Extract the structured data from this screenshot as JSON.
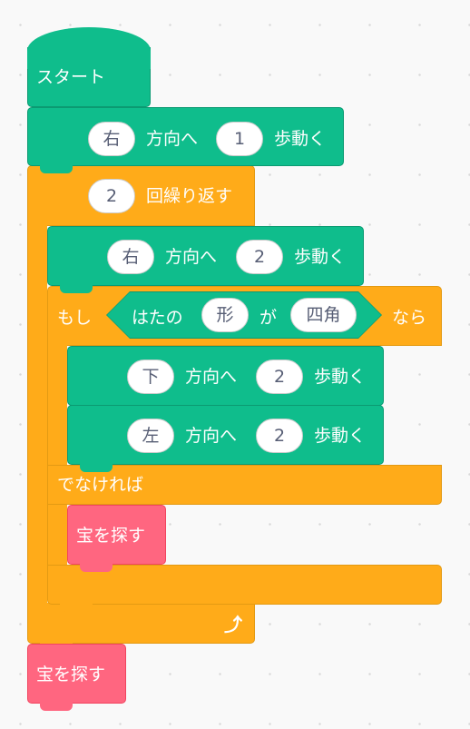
{
  "colors": {
    "motion": "#0fbd8c",
    "control": "#ffab19",
    "action": "#ff6680",
    "background": "#f9f9f9"
  },
  "start": {
    "label": "スタート"
  },
  "move1": {
    "direction": "右",
    "dir_suffix": "方向へ",
    "steps": "1",
    "steps_suffix": "歩動く"
  },
  "repeat": {
    "count": "2",
    "label": "回繰り返す",
    "loop_icon": "loop-arrow-icon"
  },
  "move2": {
    "direction": "右",
    "dir_suffix": "方向へ",
    "steps": "2",
    "steps_suffix": "歩動く"
  },
  "if_else": {
    "if_label": "もし",
    "cond_prefix": "はたの",
    "cond_attr": "形",
    "cond_mid": "が",
    "cond_value": "四角",
    "then_label": "なら",
    "else_label": "でなければ"
  },
  "move3": {
    "direction": "下",
    "dir_suffix": "方向へ",
    "steps": "2",
    "steps_suffix": "歩動く"
  },
  "move4": {
    "direction": "左",
    "dir_suffix": "方向へ",
    "steps": "2",
    "steps_suffix": "歩動く"
  },
  "search_inner": {
    "label": "宝を探す"
  },
  "search_final": {
    "label": "宝を探す"
  }
}
